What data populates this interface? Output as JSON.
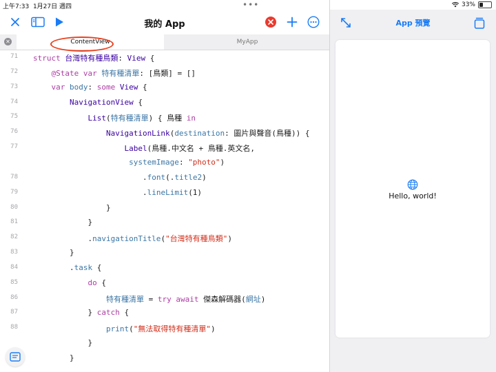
{
  "status_bar": {
    "time": "上午7:33",
    "date": "1月27日 週四",
    "battery_percent": "33%",
    "battery_level": 0.33
  },
  "toolbar": {
    "title": "我的 App"
  },
  "tabs": [
    {
      "label": "ContentView",
      "active": true
    },
    {
      "label": "MyApp",
      "active": false
    }
  ],
  "code_lines": [
    {
      "n": "71",
      "segments": [
        [
          "kw",
          "struct "
        ],
        [
          "ty",
          "台灣特有種鳥類"
        ],
        [
          "",
          ": "
        ],
        [
          "ty",
          "View"
        ],
        [
          "",
          " {"
        ]
      ]
    },
    {
      "n": "72",
      "segments": [
        [
          "kw",
          "    @State var "
        ],
        [
          "pl",
          "特有種清單"
        ],
        [
          "",
          ": [鳥類] = []"
        ]
      ]
    },
    {
      "n": "73",
      "segments": [
        [
          "kw",
          "    var "
        ],
        [
          "pl",
          "body"
        ],
        [
          "",
          ": "
        ],
        [
          "kw",
          "some "
        ],
        [
          "ty",
          "View"
        ],
        [
          "",
          " {"
        ]
      ]
    },
    {
      "n": "74",
      "segments": [
        [
          "ty",
          "        NavigationView"
        ],
        [
          "",
          " {"
        ]
      ]
    },
    {
      "n": "75",
      "segments": [
        [
          "ty",
          "            List"
        ],
        [
          "",
          "("
        ],
        [
          "pl",
          "特有種清單"
        ],
        [
          "",
          ") { 鳥種 "
        ],
        [
          "kw",
          "in"
        ]
      ]
    },
    {
      "n": "76",
      "segments": [
        [
          "ty",
          "                NavigationLink"
        ],
        [
          "",
          "("
        ],
        [
          "pl",
          "destination"
        ],
        [
          "",
          ": 圖片與聲音(鳥種)) {"
        ]
      ]
    },
    {
      "n": "77",
      "segments": [
        [
          "ty",
          "                    Label"
        ],
        [
          "",
          "(鳥種.中文名 + 鳥種.英文名,"
        ]
      ]
    },
    {
      "n": "",
      "segments": [
        [
          "",
          "                     "
        ],
        [
          "pl",
          "systemImage"
        ],
        [
          "",
          ": "
        ],
        [
          "st",
          "\"photo\""
        ],
        [
          "",
          ")"
        ]
      ]
    },
    {
      "n": "78",
      "segments": [
        [
          "",
          "                        ."
        ],
        [
          "pl",
          "font"
        ],
        [
          "",
          "(."
        ],
        [
          "pl",
          "title2"
        ],
        [
          "",
          ")"
        ]
      ]
    },
    {
      "n": "79",
      "segments": [
        [
          "",
          "                        ."
        ],
        [
          "pl",
          "lineLimit"
        ],
        [
          "",
          "(1)"
        ]
      ]
    },
    {
      "n": "80",
      "segments": [
        [
          "",
          "                }"
        ]
      ]
    },
    {
      "n": "81",
      "segments": [
        [
          "",
          "            }"
        ]
      ]
    },
    {
      "n": "82",
      "segments": [
        [
          "",
          "            ."
        ],
        [
          "pl",
          "navigationTitle"
        ],
        [
          "",
          "("
        ],
        [
          "st",
          "\"台灣特有種鳥類\""
        ],
        [
          "",
          ")"
        ]
      ]
    },
    {
      "n": "83",
      "segments": [
        [
          "",
          "        }"
        ]
      ]
    },
    {
      "n": "84",
      "segments": [
        [
          "",
          "        ."
        ],
        [
          "pl",
          "task"
        ],
        [
          "",
          " {"
        ]
      ]
    },
    {
      "n": "85",
      "segments": [
        [
          "kw",
          "            do"
        ],
        [
          "",
          " {"
        ]
      ]
    },
    {
      "n": "86",
      "segments": [
        [
          "pl",
          "                特有種清單"
        ],
        [
          "",
          " = "
        ],
        [
          "kw",
          "try await "
        ],
        [
          "",
          "傑森解碼器("
        ],
        [
          "pl",
          "網址"
        ],
        [
          "",
          ")"
        ]
      ]
    },
    {
      "n": "87",
      "segments": [
        [
          "",
          "            } "
        ],
        [
          "kw",
          "catch"
        ],
        [
          "",
          " {"
        ]
      ]
    },
    {
      "n": "88",
      "segments": [
        [
          "pl",
          "                print"
        ],
        [
          "",
          "("
        ],
        [
          "st",
          "\"無法取得特有種清單\""
        ],
        [
          "",
          ")"
        ]
      ]
    },
    {
      "n": "",
      "segments": [
        [
          "",
          "            }"
        ]
      ]
    },
    {
      "n": "",
      "segments": [
        [
          "",
          "        }"
        ]
      ]
    }
  ],
  "preview": {
    "title": "App 預覽",
    "hello_text": "Hello, world!"
  },
  "colors": {
    "accent": "#1a7cf5",
    "keyword": "#ad3da4",
    "type": "#3900a0",
    "plain_identifier": "#3b76a6",
    "string": "#d12f1b",
    "annotation": "#e8401c"
  },
  "icons": [
    "close-icon",
    "sidebar-icon",
    "play-icon",
    "error-badge-icon",
    "plus-icon",
    "more-icon",
    "expand-icon",
    "device-stack-icon",
    "globe-icon",
    "doc-list-icon"
  ]
}
